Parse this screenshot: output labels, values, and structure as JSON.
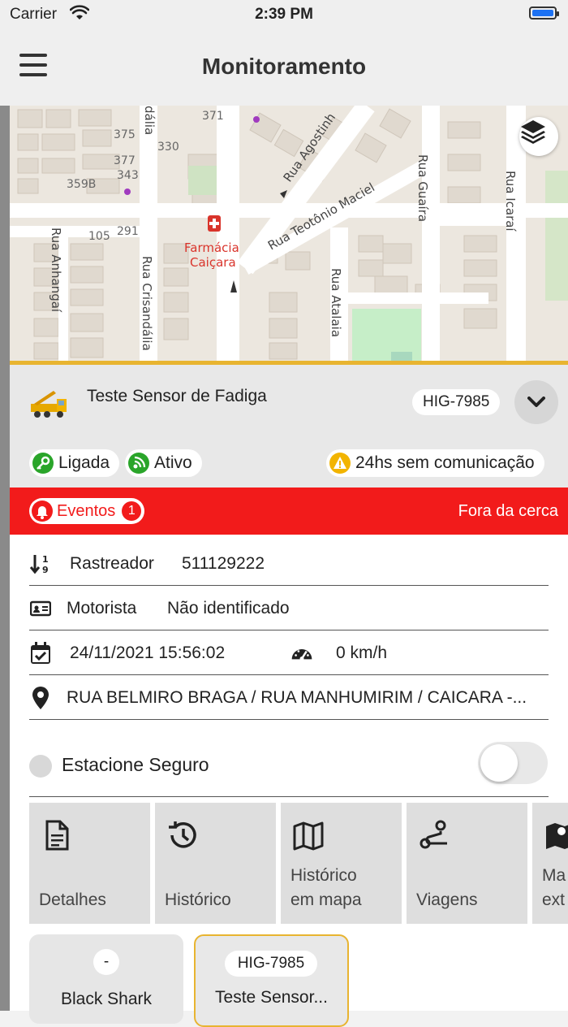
{
  "status_bar": {
    "carrier": "Carrier",
    "time": "2:39 PM"
  },
  "nav": {
    "title": "Monitoramento"
  },
  "map": {
    "streets": [
      "Rua Agostinh",
      "Rua Teotônio Maciel",
      "Rua Guaíra",
      "Rua Icaraí",
      "Rua Anhangaí",
      "Rua Crisandália",
      "Rua Atalaia",
      "dália"
    ],
    "numbers": [
      "371",
      "375",
      "330",
      "377",
      "343",
      "359B",
      "105",
      "291"
    ],
    "poi": [
      "Farmácia",
      "Caiçara"
    ]
  },
  "vehicle": {
    "name": "Teste Sensor de Fadiga",
    "plate": "HIG-7985"
  },
  "chips": {
    "ignition": "Ligada",
    "state": "Ativo",
    "comms": "24hs sem comunicação"
  },
  "events": {
    "label": "Eventos",
    "count": "1",
    "alert": "Fora da cerca"
  },
  "info": {
    "tracker_label": "Rastreador",
    "tracker_value": "511129222",
    "driver_label": "Motorista",
    "driver_value": "Não identificado",
    "datetime": "24/11/2021 15:56:02",
    "speed": "0 km/h",
    "address": "RUA BELMIRO BRAGA / RUA MANHUMIRIM / CAICARA -..."
  },
  "safe_parking": {
    "label": "Estacione Seguro",
    "enabled": false
  },
  "actions": [
    {
      "line1": "",
      "line2": "Detalhes",
      "icon": "document-icon"
    },
    {
      "line1": "",
      "line2": "Histórico",
      "icon": "history-icon"
    },
    {
      "line1": "Histórico",
      "line2": "em mapa",
      "icon": "map-icon"
    },
    {
      "line1": "",
      "line2": "Viagens",
      "icon": "route-icon"
    },
    {
      "line1": "Ma",
      "line2": "ext",
      "icon": "map-marker-icon"
    }
  ],
  "vehicle_cards": [
    {
      "plate": "-",
      "name": "Black Shark"
    },
    {
      "plate": "HIG-7985",
      "name": "Teste Sensor..."
    }
  ],
  "colors": {
    "accent": "#e8b430",
    "alert": "#f21b1b",
    "ok": "#2aa52a",
    "warn": "#f2b400"
  }
}
